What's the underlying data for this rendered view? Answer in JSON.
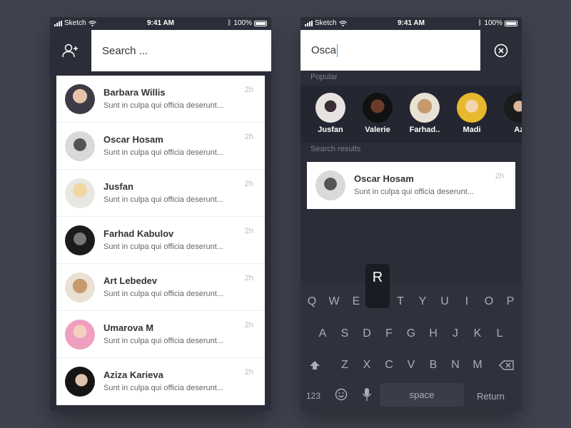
{
  "status_bar": {
    "carrier": "Sketch",
    "time": "9:41 AM",
    "battery": "100%"
  },
  "left_screen": {
    "search_placeholder": "Search ...",
    "conversations": [
      {
        "name": "Barbara Willis",
        "message": "Sunt in culpa qui officia deserunt...",
        "time": "2h"
      },
      {
        "name": "Oscar Hosam",
        "message": "Sunt in culpa qui officia deserunt...",
        "time": "2h"
      },
      {
        "name": "Jusfan",
        "message": "Sunt in culpa qui officia deserunt...",
        "time": "2h"
      },
      {
        "name": "Farhad Kabulov",
        "message": "Sunt in culpa qui officia deserunt...",
        "time": "2h"
      },
      {
        "name": "Art Lebedev",
        "message": "Sunt in culpa qui officia deserunt...",
        "time": "2h"
      },
      {
        "name": "Umarova M",
        "message": "Sunt in culpa qui officia deserunt...",
        "time": "2h"
      },
      {
        "name": "Aziza Karieva",
        "message": "Sunt in culpa qui officia deserunt...",
        "time": "2h"
      }
    ]
  },
  "right_screen": {
    "search_value": "Osca",
    "popular_label": "Popular",
    "popular": [
      {
        "name": "Jusfan"
      },
      {
        "name": "Valerie"
      },
      {
        "name": "Farhad.."
      },
      {
        "name": "Madi"
      },
      {
        "name": "Az"
      }
    ],
    "results_label": "Search results",
    "result": {
      "name": "Oscar Hosam",
      "message": "Sunt in culpa qui officia deserunt...",
      "time": "2h"
    },
    "keyboard": {
      "popup_key": "R",
      "row1": [
        "Q",
        "W",
        "E",
        "",
        "T",
        "Y",
        "U",
        "I",
        "O",
        "P"
      ],
      "row2": [
        "A",
        "S",
        "D",
        "F",
        "G",
        "H",
        "J",
        "K",
        "L"
      ],
      "row3": [
        "Z",
        "X",
        "C",
        "V",
        "B",
        "N",
        "M"
      ],
      "numbers_label": "123",
      "space_label": "space",
      "return_label": "Return"
    }
  },
  "colors": {
    "background": "#40434f",
    "phone_bg": "#2b2e38",
    "cursor": "#4a90e2"
  }
}
